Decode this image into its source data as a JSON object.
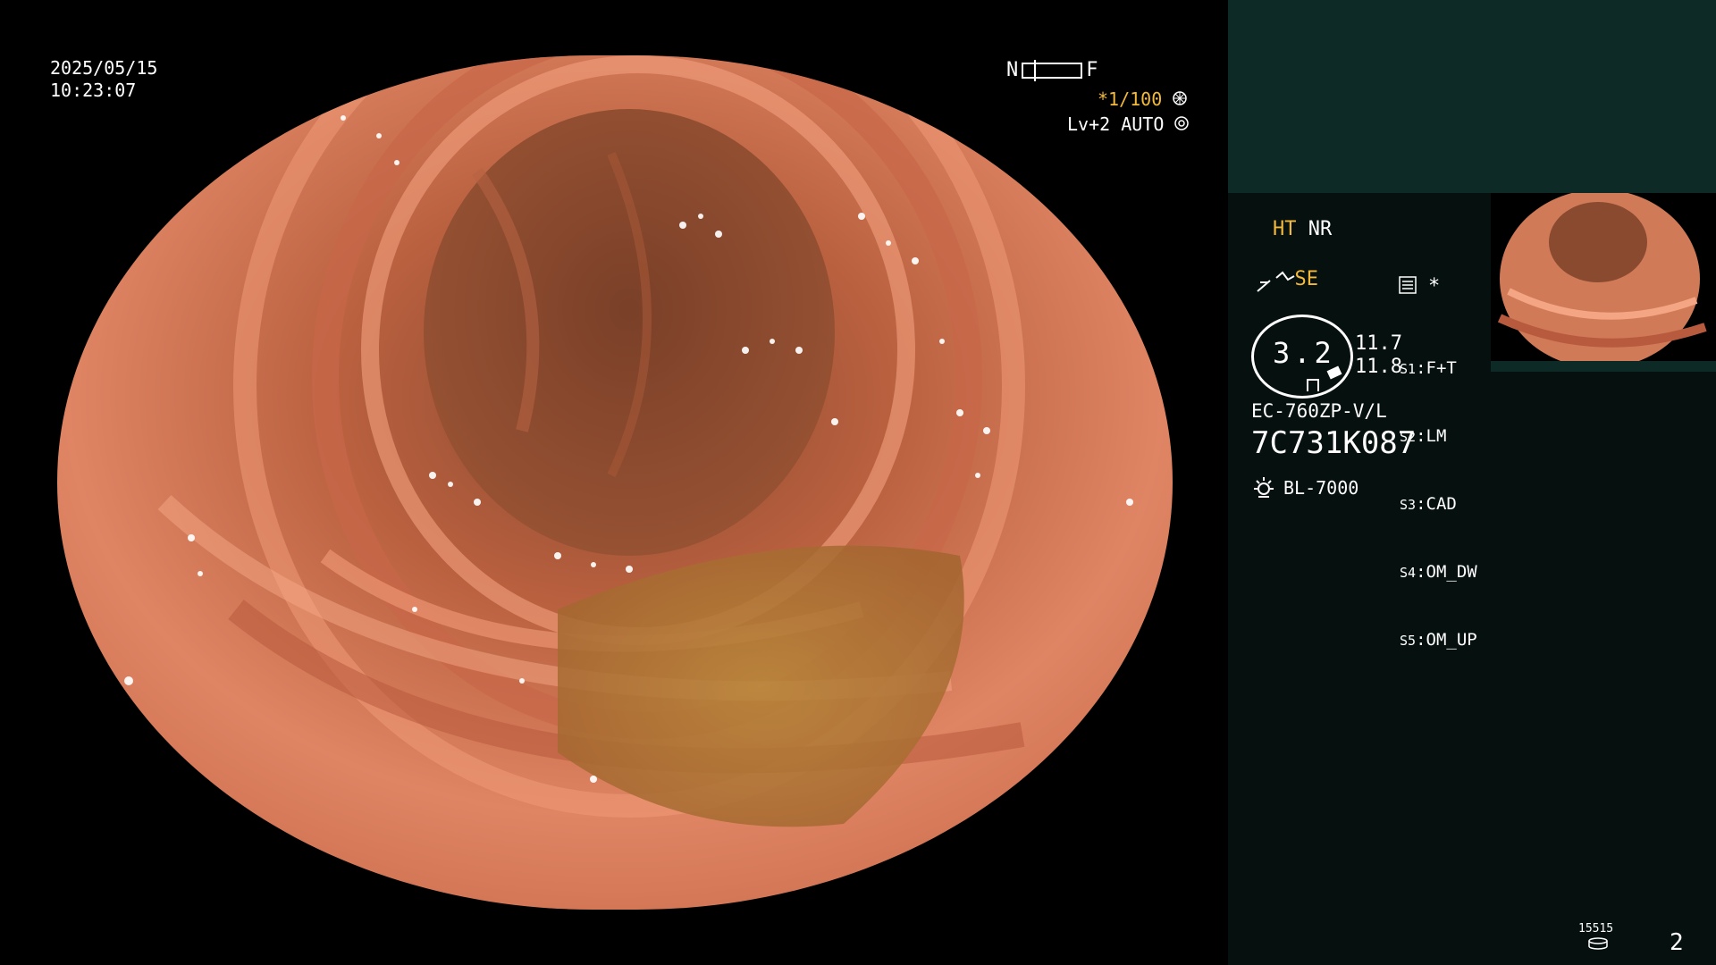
{
  "overlay": {
    "date": "2025/05/15",
    "time": "10:23:07",
    "nf_left": "N",
    "nf_right": "F",
    "shutter": "*1/100",
    "level": "Lv+2",
    "mode": "AUTO"
  },
  "panel": {
    "ht": "HT",
    "nr": "NR",
    "se": "SE",
    "zoom_value": "3.2",
    "value_1": "11.7",
    "value_2": "11.8",
    "scope_model": "EC-760ZP-V/L",
    "serial": "7C731K087",
    "light_source": "BL-7000",
    "switches": [
      {
        "key": "S1",
        "label": "F+T"
      },
      {
        "key": "S2",
        "label": "LM"
      },
      {
        "key": "S3",
        "label": "CAD"
      },
      {
        "key": "S4",
        "label": "OM_DW"
      },
      {
        "key": "S5",
        "label": "OM_UP"
      }
    ],
    "asterisk": "*",
    "counter": "15515",
    "page_number": "2"
  },
  "colors": {
    "panel_top": "#0d2a27",
    "panel_body": "#05100f",
    "accent_yellow": "#f2b93b",
    "tissue": "#d97a5c"
  },
  "icons": {
    "shutter": "aperture-icon",
    "auto": "auto-iris-icon",
    "se": "scope-enhance-icon",
    "freeze": "freeze-icon",
    "memory": "memo-icon",
    "light": "lamp-icon",
    "counter": "disk-icon"
  }
}
